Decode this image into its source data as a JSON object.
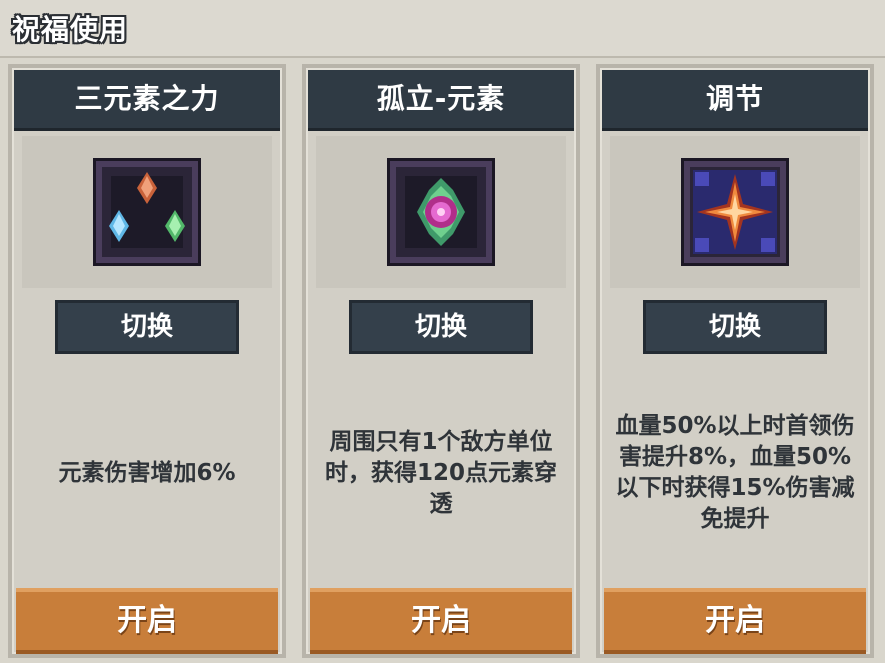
{
  "panel": {
    "title": "祝福使用"
  },
  "cards": [
    {
      "title": "三元素之力",
      "icon": "three-elements-icon",
      "switch_label": "切换",
      "description": "元素伤害增加6%",
      "open_label": "开启"
    },
    {
      "title": "孤立-元素",
      "icon": "isolated-element-icon",
      "switch_label": "切换",
      "description": "周围只有1个敌方单位时，获得120点元素穿透",
      "open_label": "开启"
    },
    {
      "title": "调节",
      "icon": "regulate-icon",
      "switch_label": "切换",
      "description": "血量50%以上时首领伤害提升8%，血量50%以下时获得15%伤害减免提升",
      "open_label": "开启"
    }
  ],
  "colors": {
    "header_bg": "#2f3a44",
    "open_button": "#c87e3a",
    "switch_button": "#34404b"
  }
}
